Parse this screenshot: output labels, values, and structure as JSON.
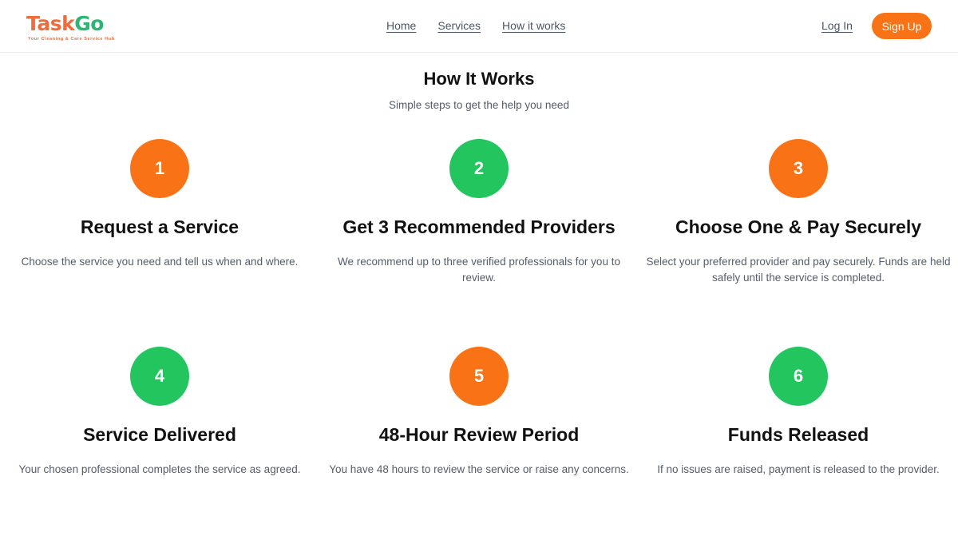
{
  "brand": {
    "name_part1": "Task",
    "name_part2": "Go",
    "tagline": "Your Cleaning & Care Service Hub",
    "colors": {
      "orange": "#f97316",
      "green": "#22c55e"
    }
  },
  "nav": {
    "links": [
      "Home",
      "Services",
      "How it works"
    ],
    "login": "Log In",
    "signup": "Sign Up"
  },
  "section": {
    "title": "How It Works",
    "subtitle": "Simple steps to get the help you need"
  },
  "steps": [
    {
      "number": "1",
      "color": "orange",
      "title": "Request a Service",
      "description": "Choose the service you need and tell us when and where."
    },
    {
      "number": "2",
      "color": "green",
      "title": "Get 3 Recommended Providers",
      "description": "We recommend up to three verified professionals for you to review."
    },
    {
      "number": "3",
      "color": "orange",
      "title": "Choose One & Pay Securely",
      "description": "Select your preferred provider and pay securely. Funds are held safely until the service is completed."
    },
    {
      "number": "4",
      "color": "green",
      "title": "Service Delivered",
      "description": "Your chosen professional completes the service as agreed."
    },
    {
      "number": "5",
      "color": "orange",
      "title": "48-Hour Review Period",
      "description": "You have 48 hours to review the service or raise any concerns."
    },
    {
      "number": "6",
      "color": "green",
      "title": "Funds Released",
      "description": "If no issues are raised, payment is released to the provider."
    }
  ]
}
